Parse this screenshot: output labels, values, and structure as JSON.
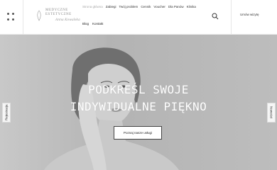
{
  "brand": {
    "line1": "MEDYCZNE",
    "line2": "ESTETYCZNE",
    "signature": "Anna Kowalska"
  },
  "nav": {
    "row1": [
      "Strona główna",
      "Zabiegi",
      "Twój problem",
      "Cennik",
      "Voucher",
      "Dla Panów",
      "Klinika"
    ],
    "row2": [
      "Blog",
      "Kontakt"
    ]
  },
  "header": {
    "cta_label": "Umów wizytę"
  },
  "hero": {
    "headline_line1": "PODKREŚL SWOJE",
    "headline_line2": "INDYWIDUALNE PIĘKNO",
    "button_label": "Poznaj nasze usługi"
  },
  "side_tabs": {
    "left": "Rejestracja",
    "right": "Nowości"
  },
  "colors": {
    "hero_bg": "#b9b9b9",
    "accent": "#444444"
  }
}
